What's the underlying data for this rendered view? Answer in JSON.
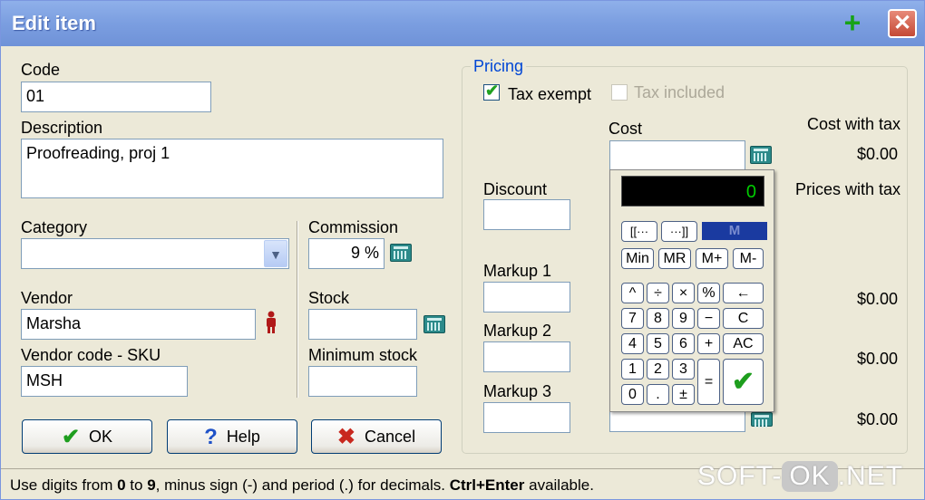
{
  "window": {
    "title": "Edit item",
    "add_icon": "plus-icon",
    "close_icon": "close-icon",
    "close_glyph": "✕"
  },
  "fields": {
    "code": {
      "label": "Code",
      "value": "01"
    },
    "description": {
      "label": "Description",
      "value": "Proofreading, proj 1"
    },
    "category": {
      "label": "Category",
      "value": ""
    },
    "commission": {
      "label": "Commission",
      "value": "9 %"
    },
    "vendor": {
      "label": "Vendor",
      "value": "Marsha"
    },
    "stock": {
      "label": "Stock",
      "value": ""
    },
    "vendor_code": {
      "label": "Vendor code - SKU",
      "value": "MSH"
    },
    "minimum_stock": {
      "label": "Minimum stock",
      "value": ""
    }
  },
  "buttons": {
    "ok": "OK",
    "help": "Help",
    "cancel": "Cancel"
  },
  "pricing": {
    "title": "Pricing",
    "tax_exempt": {
      "label": "Tax exempt",
      "checked": true
    },
    "tax_included": {
      "label": "Tax included",
      "checked": false
    },
    "cost_label": "Cost",
    "cost_with_tax_label": "Cost with tax",
    "cost_with_tax_value": "$0.00",
    "discount_label": "Discount",
    "prices_with_tax_label": "Prices with tax",
    "markup1_label": "Markup 1",
    "markup1_value": "$0.00",
    "markup2_label": "Markup 2",
    "markup2_value": "$0.00",
    "markup3_label": "Markup 3",
    "markup3_value": "$0.00"
  },
  "calculator": {
    "display": "0",
    "memory_indicator": "M",
    "keys": {
      "k1": "[[···",
      "k2": "···]]",
      "min": "Min",
      "mr": "MR",
      "mplus": "M+",
      "mminus": "M-",
      "pow": "^",
      "div": "÷",
      "mul": "×",
      "pct": "%",
      "back": "←",
      "n7": "7",
      "n8": "8",
      "n9": "9",
      "minus": "−",
      "c": "C",
      "n4": "4",
      "n5": "5",
      "n6": "6",
      "plus": "+",
      "ac": "AC",
      "n1": "1",
      "n2": "2",
      "n3": "3",
      "eq": "=",
      "ok": "✔",
      "n0": "0",
      "dot": ".",
      "pm": "±"
    }
  },
  "status": {
    "p1": "Use digits from ",
    "b1": "0",
    "p2": " to ",
    "b2": "9",
    "p3": ", minus sign (-) and period (.) for decimals. ",
    "b3": "Ctrl+Enter",
    "p4": " available."
  },
  "watermark": {
    "left": "SOFT-",
    "ok": "OK",
    "right": ".NET"
  }
}
